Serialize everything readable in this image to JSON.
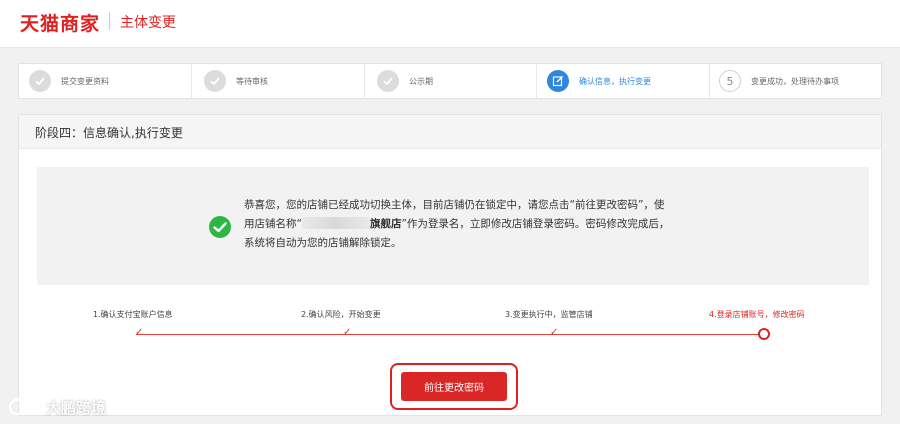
{
  "header": {
    "brand": "天猫商家",
    "title": "主体变更"
  },
  "steps": [
    {
      "label": "提交变更资料",
      "state": "done",
      "icon": "check-icon"
    },
    {
      "label": "等待审核",
      "state": "done",
      "icon": "check-icon"
    },
    {
      "label": "公示期",
      "state": "done",
      "icon": "check-icon"
    },
    {
      "label": "确认信息，执行变更",
      "state": "active",
      "icon": "edit-icon"
    },
    {
      "label": "变更成功，处理待办事项",
      "state": "todo",
      "number": "5"
    }
  ],
  "card": {
    "title": "阶段四：信息确认,执行变更",
    "message": {
      "part1": "恭喜您，您的店铺已经成功切换主体，目前店铺仍在锁定中，请您点击“前往更改密码”，使用店铺名称“",
      "store_suffix": "旗舰店",
      "part2": "”作为登录名，立即修改店铺登录密码。密码修改完成后，系统将自动为您的店铺解除锁定。"
    }
  },
  "progress": [
    {
      "label": "1.确认支付宝账户信息",
      "state": "done"
    },
    {
      "label": "2.确认风险，开始变更",
      "state": "done"
    },
    {
      "label": "3.变更执行中，监管店铺",
      "state": "done"
    },
    {
      "label": "4.登录店铺账号，修改密码",
      "state": "current"
    }
  ],
  "button": {
    "label": "前往更改密码"
  },
  "watermark": {
    "text": "大鹏跨境"
  },
  "colors": {
    "accent": "#e02020",
    "active_step": "#2e86de",
    "success": "#2db742"
  }
}
